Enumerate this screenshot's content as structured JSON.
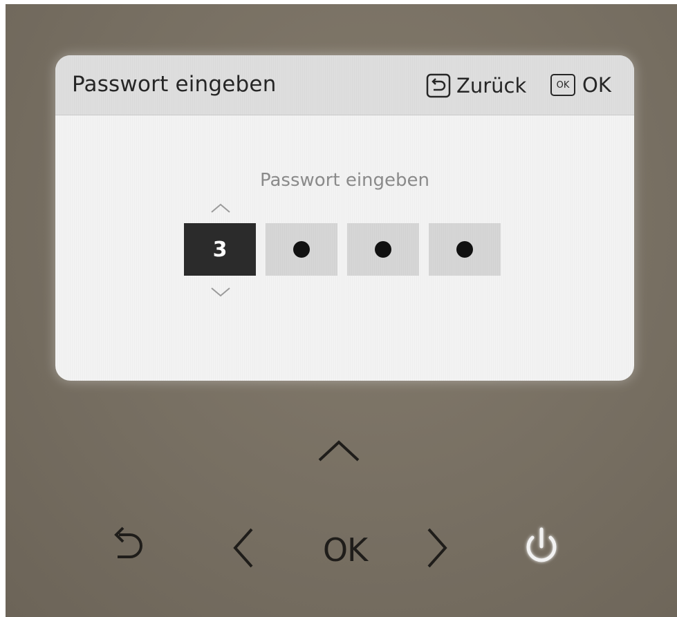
{
  "screen": {
    "header": {
      "title": "Passwort eingeben",
      "back_label": "Zurück",
      "ok_icon_text": "OK",
      "ok_label": "OK"
    },
    "prompt": "Passwort eingeben",
    "pin": {
      "active_digit": "3",
      "masked_count": 3
    }
  },
  "hardware_buttons": {
    "ok_label": "OK",
    "icons": [
      "back-arrow-icon",
      "up-arrow-icon",
      "left-arrow-icon",
      "right-arrow-icon",
      "power-icon"
    ]
  },
  "colors": {
    "panel": "#776f62",
    "screen_bg": "#f3f3f3",
    "header_bg": "#dedede",
    "active_digit_bg": "#2b2b2b",
    "masked_digit_bg": "#d6d6d6",
    "power_glow": "#f2f2f2"
  }
}
